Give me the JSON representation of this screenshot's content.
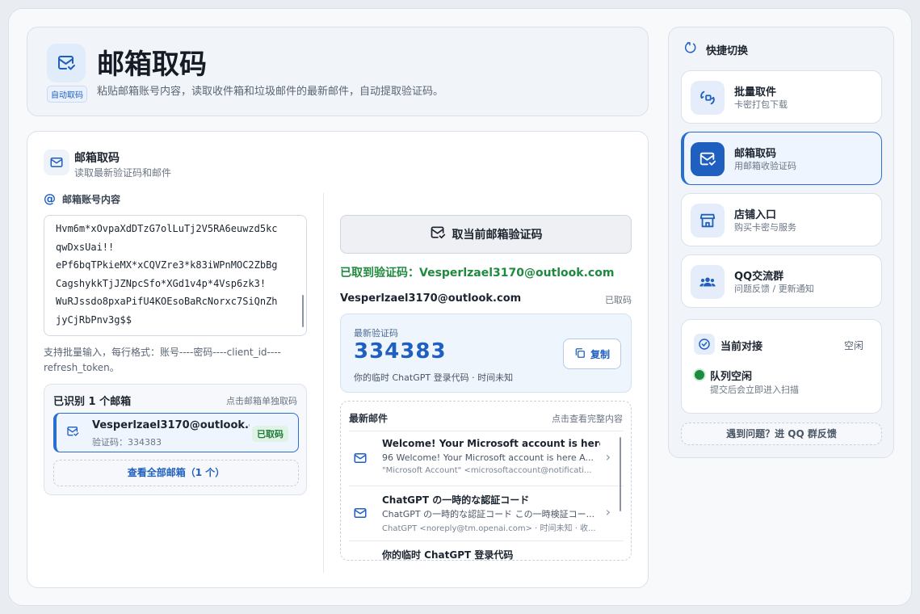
{
  "header": {
    "title": "邮箱取码",
    "subtitle": "粘贴邮箱账号内容，读取收件箱和垃圾邮件的最新邮件，自动提取验证码。",
    "badge": "自动取码"
  },
  "section": {
    "title": "邮箱取码",
    "subtitle": "读取最新验证码和邮件"
  },
  "input": {
    "label": "邮箱账号内容",
    "lines": [
      "Hvm6m*xOvpaXdDTzG7olLuTj2V5RA6euwzd5kc",
      "qwDxsUai!!",
      "ePf6bqTPkieMX*xCQVZre3*k83iWPnMOC2ZbBg",
      "CagshykkTjJZNpcSfo*XGd1v4p*4Vsp6zk3!",
      "WuRJssdo8pxaPifU4KOEsoBaRcNorxc7SiQnZh",
      "jyCjRbPnv3g$$"
    ],
    "hint": "支持批量输入，每行格式：账号----密码----client_id----refresh_token。"
  },
  "recognized": {
    "title": "已识别 1 个邮箱",
    "link": "点击邮箱单独取码",
    "items": [
      {
        "email": "Vesperlzael3170@outlook.com",
        "code_text": "验证码：334383",
        "badge": "已取码"
      }
    ],
    "view_all": "查看全部邮箱（1 个）"
  },
  "action": {
    "get_code_label": "取当前邮箱验证码",
    "success": "已取到验证码：Vesperlzael3170@outlook.com",
    "current_email": "Vesperlzael3170@outlook.com",
    "current_status": "已取码"
  },
  "code": {
    "label": "最新验证码",
    "value": "334383",
    "desc": "你的临时 ChatGPT 登录代码 · 时间未知",
    "copy_label": "复制"
  },
  "mails": {
    "title": "最新邮件",
    "link": "点击查看完整内容",
    "items": [
      {
        "subject": "Welcome! Your Microsoft account is here",
        "preview": "96 Welcome! Your Microsoft account is here A...",
        "from": "\"Microsoft Account\" <microsoftaccount@notificati..."
      },
      {
        "subject": "ChatGPT の一時的な認証コード",
        "preview": "ChatGPT の一時的な認証コード この一時検証コー...",
        "from": "ChatGPT <noreply@tm.openai.com> · 时间未知 · 收..."
      },
      {
        "subject": "你的临时 ChatGPT 登录代码",
        "preview": "",
        "from": ""
      }
    ]
  },
  "sidebar": {
    "title": "快捷切换",
    "items": [
      {
        "title": "批量取件",
        "sub": "卡密打包下载",
        "icon": "swap-icon"
      },
      {
        "title": "邮箱取码",
        "sub": "用邮箱收验证码",
        "icon": "mail-check-icon"
      },
      {
        "title": "店铺入口",
        "sub": "购买卡密与服务",
        "icon": "store-icon"
      },
      {
        "title": "QQ交流群",
        "sub": "问题反馈 / 更新通知",
        "icon": "group-icon"
      }
    ],
    "status": {
      "title": "当前对接",
      "state": "空闲",
      "queue": "队列空闲",
      "desc": "提交后会立即进入扫描"
    },
    "feedback": "遇到问题？进 QQ 群反馈"
  },
  "colors": {
    "accent": "#1f5fbf",
    "success": "#1f8a3f"
  }
}
